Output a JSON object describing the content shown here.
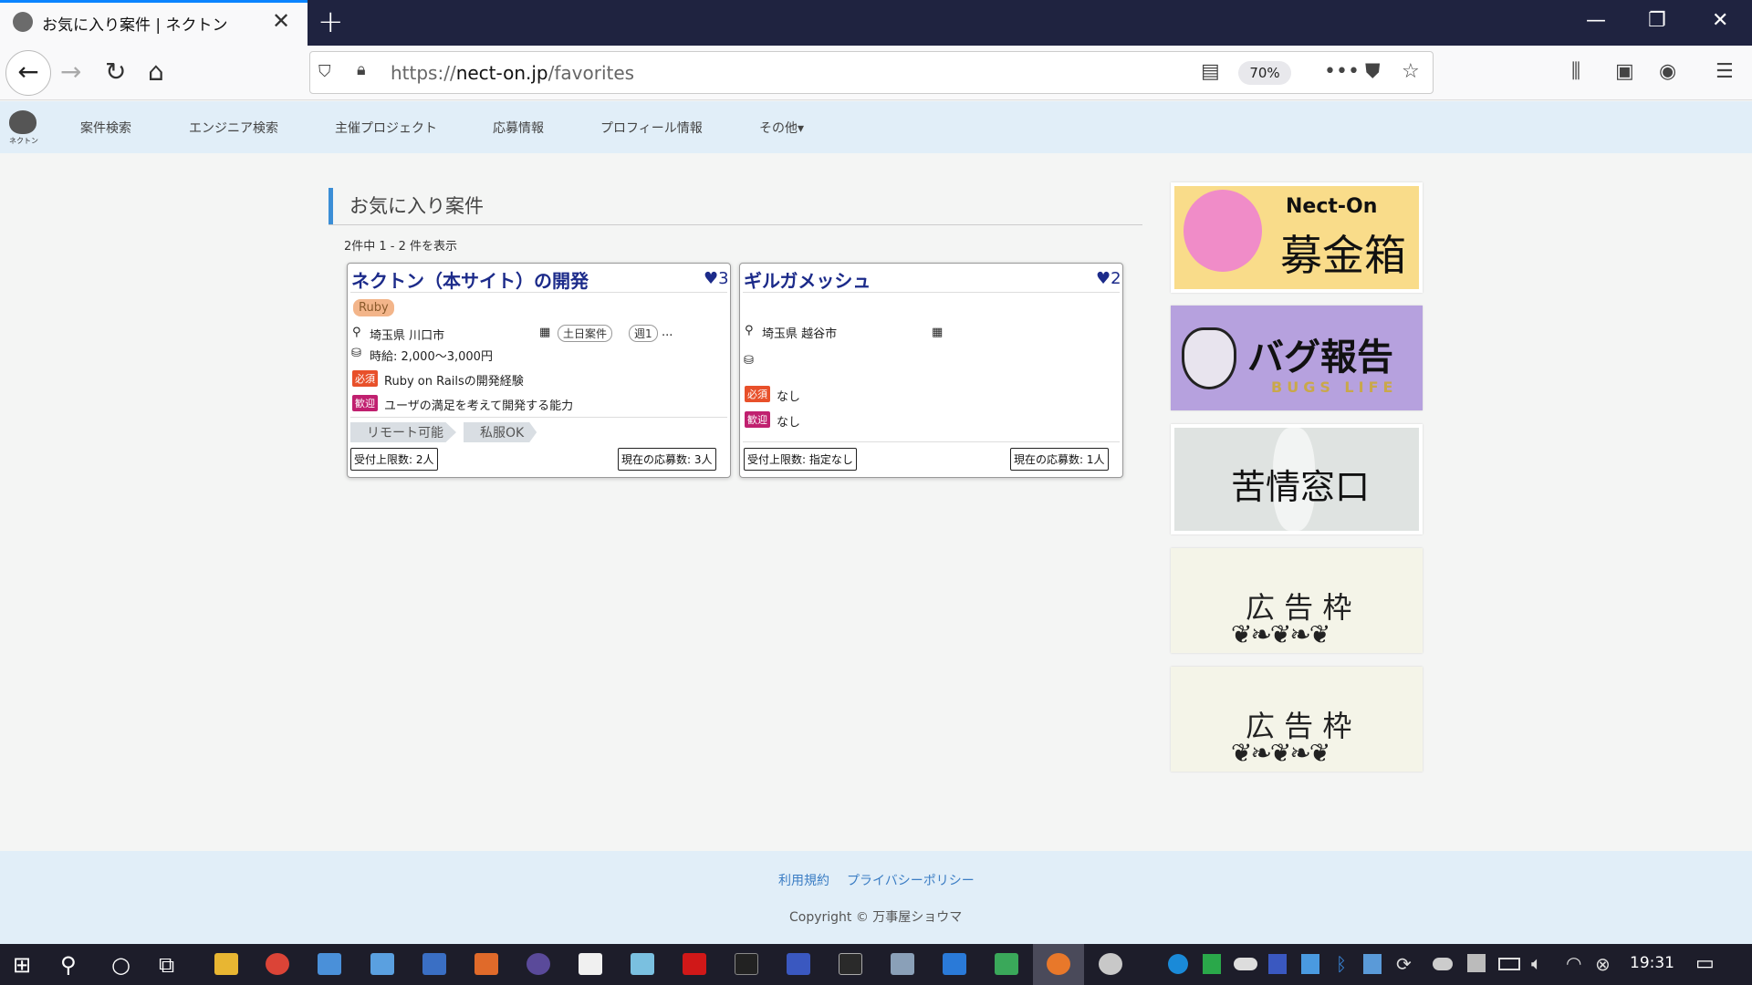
{
  "browser": {
    "tab_title": "お気に入り案件 | ネクトン",
    "tab_close": "✕",
    "new_tab": "+",
    "url_scheme": "https://",
    "url_host": "nect-on.jp",
    "url_path": "/favorites",
    "zoom": "70%",
    "window_minimize": "—",
    "window_restore": "❐",
    "window_close": "✕"
  },
  "site_nav": {
    "logo_text": "ネクトン",
    "links": [
      "案件検索",
      "エンジニア検索",
      "主催プロジェクト",
      "応募情報",
      "プロフィール情報",
      "その他▾"
    ]
  },
  "main": {
    "heading": "お気に入り案件",
    "result_count": "2件中 1 - 2 件を表示",
    "cards": [
      {
        "title": "ネクトン（本サイト）の開発",
        "favorites": "3",
        "skill": "Ruby",
        "location": "埼玉県 川口市",
        "schedule_tags": [
          "土日案件",
          "週1"
        ],
        "schedule_more": "...",
        "pay": "時給: 2,000〜3,000円",
        "required_badge": "必須",
        "required": "Ruby on Railsの開発経験",
        "welcome_badge": "歓迎",
        "welcome": "ユーザの満足を考えて開発する能力",
        "chips": [
          "リモート可能",
          "私服OK"
        ],
        "limit": "受付上限数: 2人",
        "applicants": "現在の応募数: 3人"
      },
      {
        "title": "ギルガメッシュ",
        "favorites": "2",
        "location": "埼玉県 越谷市",
        "required_badge": "必須",
        "required": "なし",
        "welcome_badge": "歓迎",
        "welcome": "なし",
        "limit": "受付上限数: 指定なし",
        "applicants": "現在の応募数: 1人"
      }
    ]
  },
  "sidebar": {
    "donation": {
      "title": "Nect-On",
      "subtitle": "募金箱"
    },
    "bug": {
      "title": "バグ報告",
      "subtitle": "BUGS LIFE"
    },
    "complaint": {
      "title": "苦情窓口"
    },
    "ad1": {
      "title": "広 告 枠"
    },
    "ad2": {
      "title": "広 告 枠"
    }
  },
  "footer": {
    "terms": "利用規約",
    "privacy": "プライバシーポリシー",
    "copyright": "Copyright © 万事屋ショウマ"
  },
  "taskbar": {
    "clock": "19:31"
  },
  "colors": {
    "accent": "#3b8ed6",
    "card_title": "#1c2b8a",
    "nav_bg": "#e1eef8",
    "required": "#e8502a",
    "welcome": "#c0206f"
  }
}
